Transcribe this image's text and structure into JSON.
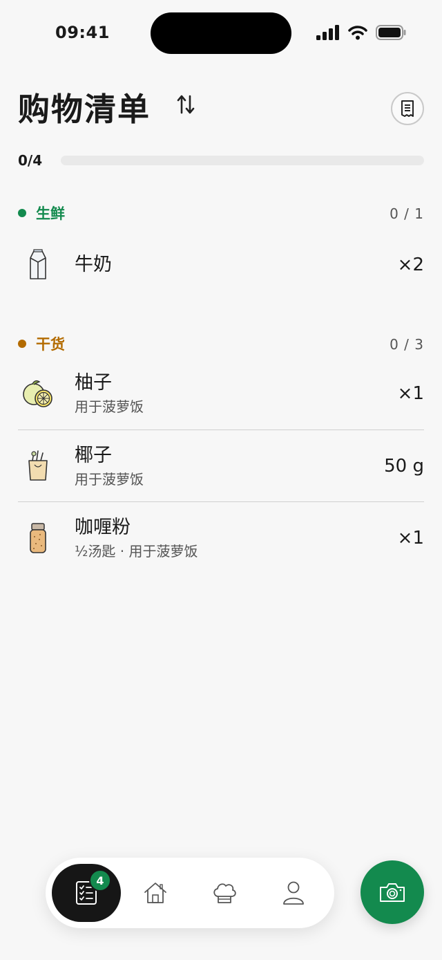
{
  "status_bar": {
    "time": "09:41"
  },
  "header": {
    "title": "购物清单"
  },
  "progress": {
    "label": "0/4",
    "value": 0
  },
  "sections": [
    {
      "title": "生鲜",
      "count": "0 / 1",
      "color": "#138a4e",
      "items": [
        {
          "name": "牛奶",
          "note": "",
          "qty": "×2",
          "icon": "milk-carton-icon"
        }
      ]
    },
    {
      "title": "干货",
      "count": "0 / 3",
      "color": "#b36b00",
      "items": [
        {
          "name": "柚子",
          "note": "用于菠萝饭",
          "qty": "×1",
          "icon": "pomelo-icon"
        },
        {
          "name": "椰子",
          "note": "用于菠萝饭",
          "qty": "50 g",
          "icon": "grocery-bag-icon"
        },
        {
          "name": "咖喱粉",
          "note": "½汤匙 · 用于菠萝饭",
          "qty": "×1",
          "icon": "spice-jar-icon"
        }
      ]
    }
  ],
  "tabbar": {
    "badge": "4",
    "tabs": [
      "checklist-icon",
      "home-icon",
      "chef-hat-icon",
      "profile-icon"
    ]
  },
  "colors": {
    "accent": "#138a4e",
    "dry_goods": "#b36b00"
  }
}
